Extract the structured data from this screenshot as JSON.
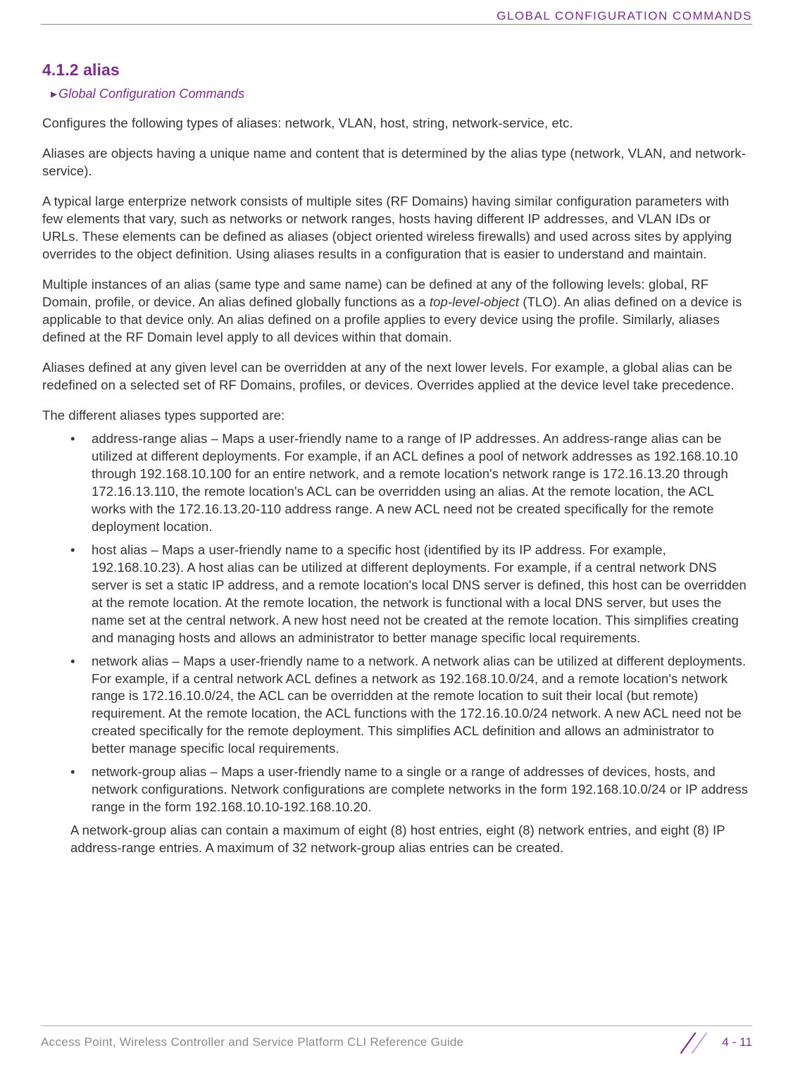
{
  "header": {
    "category": "GLOBAL CONFIGURATION COMMANDS"
  },
  "section": {
    "number_title": "4.1.2 alias",
    "breadcrumb": "Global Configuration Commands"
  },
  "paragraphs": {
    "intro": "Configures the following types of aliases: network, VLAN, host, string, network-service, etc.",
    "p2": "Aliases are objects having a unique name and content that is determined by the alias type (network, VLAN, and network-service).",
    "p3": "A typical large enterprize network consists of multiple sites (RF Domains) having similar configuration parameters with few elements that vary, such as networks or network ranges, hosts having different IP addresses, and VLAN IDs or URLs. These elements can be defined as aliases (object oriented wireless firewalls) and used across sites by applying overrides to the object definition. Using aliases results in a configuration that is easier to understand and maintain.",
    "p4a": "Multiple instances of an alias (same type and same name) can be defined at any of the following levels: global, RF Domain, profile, or device. An alias defined globally functions as a ",
    "p4_tlo": "top-level-object",
    "p4b": " (TLO). An alias defined on a device is applicable to that device only. An alias defined on a profile applies to every device using the profile. Similarly, aliases defined at the RF Domain level apply to all devices within that domain.",
    "p5": "Aliases defined at any given level can be overridden at any of the next lower levels. For example, a global alias can be redefined on a selected set of RF Domains, profiles, or devices. Overrides applied at the device level take precedence.",
    "p6": "The different aliases types supported are:"
  },
  "bullets": {
    "b1": "address-range alias – Maps a user-friendly name to a range of IP addresses. An address-range alias can be utilized at different deployments. For example, if an ACL defines a pool of network addresses as 192.168.10.10 through 192.168.10.100 for an entire network, and a remote location's network range is 172.16.13.20 through 172.16.13.110, the remote location's ACL can be overridden using an alias. At the remote location, the ACL works with the 172.16.13.20-110 address range. A new ACL need not be created specifically for the remote deployment location.",
    "b2": "host alias – Maps a user-friendly name to a specific host (identified by its IP address. For example, 192.168.10.23). A host alias can be utilized at different deployments. For example, if a central network DNS server is set a static IP address, and a remote location's local DNS server is defined, this host can be overridden at the remote location. At the remote location, the network is functional with a local DNS server, but uses the name set at the central network. A new host need not be created at the remote location. This simplifies creating and managing hosts and allows an administrator to better manage specific local requirements.",
    "b3": "network alias – Maps a user-friendly name to a network. A network alias can be utilized at different deployments. For example, if a central network ACL defines a network as 192.168.10.0/24, and a remote location's network range is 172.16.10.0/24, the ACL can be overridden at the remote location to suit their local (but remote) requirement. At the remote location, the ACL functions with the 172.16.10.0/24 network. A new ACL need not be created specifically for the remote deployment. This simplifies ACL definition and allows an administrator to better manage specific local requirements.",
    "b4": "network-group alias – Maps a user-friendly name to a single or a range of addresses of devices, hosts, and network configurations. Network configurations are complete networks in the form 192.168.10.0/24 or IP address range in the form 192.168.10.10-192.168.10.20."
  },
  "post_list": "A network-group alias can contain a maximum of eight (8) host entries, eight (8) network entries, and eight (8) IP address-range entries. A maximum of 32 network-group alias entries can be created.",
  "footer": {
    "left": "Access Point, Wireless Controller and Service Platform CLI Reference Guide",
    "page": "4 - 11"
  }
}
